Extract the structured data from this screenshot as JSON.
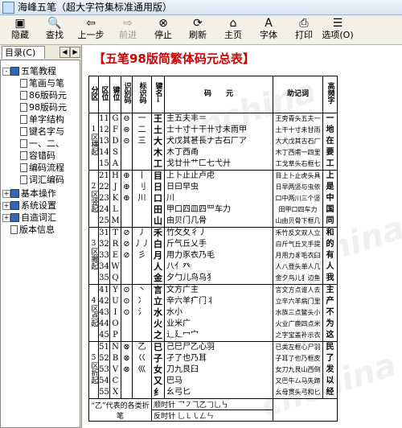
{
  "window": {
    "title": "海峰五笔（超大字符集标准通用版）"
  },
  "toolbar": {
    "buttons": [
      {
        "id": "hide",
        "label": "隐藏",
        "icon": "hide-icon",
        "glyph": "▣"
      },
      {
        "id": "find",
        "label": "查找",
        "icon": "find-icon",
        "glyph": "🔍"
      },
      {
        "id": "back",
        "label": "上一步",
        "icon": "back-arrow-icon",
        "glyph": "⇦"
      },
      {
        "id": "forward",
        "label": "前进",
        "icon": "forward-arrow-icon",
        "glyph": "⇨",
        "disabled": true
      },
      {
        "id": "stop",
        "label": "停止",
        "icon": "stop-icon",
        "glyph": "⊗"
      },
      {
        "id": "refresh",
        "label": "刷新",
        "icon": "refresh-icon",
        "glyph": "⟳"
      },
      {
        "id": "home",
        "label": "主页",
        "icon": "home-icon",
        "glyph": "⌂"
      },
      {
        "id": "font",
        "label": "字体",
        "icon": "font-icon",
        "glyph": "A"
      },
      {
        "id": "print",
        "label": "打印",
        "icon": "print-icon",
        "glyph": "⎙"
      },
      {
        "id": "options",
        "label": "选项(O)",
        "icon": "options-icon",
        "glyph": "☰"
      }
    ]
  },
  "sidebar": {
    "tab_label": "目录(C)",
    "tree": [
      {
        "label": "五笔教程",
        "type": "book",
        "level": 0,
        "expander": "-"
      },
      {
        "label": "笔画与笔",
        "type": "doc",
        "level": 1
      },
      {
        "label": "86版码元",
        "type": "doc",
        "level": 1
      },
      {
        "label": "98版码元",
        "type": "doc",
        "level": 1
      },
      {
        "label": "单字结构",
        "type": "doc",
        "level": 1
      },
      {
        "label": "键名字与",
        "type": "doc",
        "level": 1
      },
      {
        "label": "一、二、",
        "type": "doc",
        "level": 1
      },
      {
        "label": "容错码",
        "type": "doc",
        "level": 1
      },
      {
        "label": "编码流程",
        "type": "doc",
        "level": 1
      },
      {
        "label": "词汇编码",
        "type": "doc",
        "level": 1
      },
      {
        "label": "基本操作",
        "type": "book",
        "level": 0,
        "expander": "+"
      },
      {
        "label": "系统设置",
        "type": "book",
        "level": 0,
        "expander": "+"
      },
      {
        "label": "自造词汇",
        "type": "book",
        "level": 0,
        "expander": "+"
      },
      {
        "label": "版本信息",
        "type": "doc",
        "level": 0
      }
    ]
  },
  "content": {
    "page_title": "【五笔98版简繁体码元总表】",
    "watermark": "cnchina",
    "headers": {
      "zone": "分区",
      "pos": "区位",
      "key": "键位",
      "code": "识别码",
      "mark": "标识码",
      "keyname": "键名↓",
      "elements": "码　　元",
      "mnemonic": "助记词",
      "freq": "高频字"
    },
    "zones": [
      {
        "label": "1区横起",
        "rows": [
          {
            "pos": "11",
            "key": "G",
            "code": "⊖",
            "mark": "一",
            "keyname": "王",
            "elements": "主五夫丰＝",
            "mnemonic": "王旁青头五夫一",
            "freq": "一"
          },
          {
            "pos": "12",
            "key": "F",
            "code": "⊜",
            "mark": "二",
            "keyname": "土",
            "elements": "士十寸十干卄寸未雨甲",
            "mnemonic": "土干十寸未甘雨",
            "freq": "地"
          },
          {
            "pos": "13",
            "key": "D",
            "code": "⊝",
            "mark": "三",
            "keyname": "大",
            "elements": "犬戊其甚長ナ古石厂ア",
            "mnemonic": "大犬戊其古石厂",
            "freq": "在"
          },
          {
            "pos": "14",
            "key": "S",
            "code": "",
            "mark": "",
            "keyname": "木",
            "elements": "木丁西甬",
            "mnemonic": "木丁西甫一四里",
            "freq": "要"
          },
          {
            "pos": "15",
            "key": "A",
            "code": "",
            "mark": "",
            "keyname": "工",
            "elements": "戈廿卄艹匚七弋廾",
            "mnemonic": "工戈草头右框七",
            "freq": "工"
          }
        ]
      },
      {
        "label": "2区竖起",
        "rows": [
          {
            "pos": "21",
            "key": "H",
            "code": "⊕",
            "mark": "丨",
            "keyname": "目",
            "elements": "上卜止止卢虍",
            "mnemonic": "目上卜止虎头具",
            "freq": "上"
          },
          {
            "pos": "22",
            "key": "J",
            "code": "⊕",
            "mark": "刂",
            "keyname": "日",
            "elements": "日曰早虫",
            "mnemonic": "日早两竖与虫依",
            "freq": "是"
          },
          {
            "pos": "23",
            "key": "K",
            "code": "⊕",
            "mark": "川",
            "keyname": "口",
            "elements": "川",
            "mnemonic": "口中两川三个竖",
            "freq": "中"
          },
          {
            "pos": "24",
            "key": "L",
            "code": "",
            "mark": "",
            "keyname": "田",
            "elements": "甲口四皿四罒车力",
            "mnemonic": "田甲口四车力",
            "freq": "国"
          },
          {
            "pos": "25",
            "key": "M",
            "code": "",
            "mark": "",
            "keyname": "山",
            "elements": "由贝门几骨",
            "mnemonic": "山由贝骨下框几",
            "freq": "同"
          }
        ]
      },
      {
        "label": "3区撇起",
        "rows": [
          {
            "pos": "31",
            "key": "T",
            "code": "⊘",
            "mark": "丿",
            "keyname": "禾",
            "elements": "竹攵夂彳丿",
            "mnemonic": "禾竹反文双人立",
            "freq": "和"
          },
          {
            "pos": "32",
            "key": "R",
            "code": "⊘",
            "mark": "丿丿",
            "keyname": "白",
            "elements": "斤气丘乂手",
            "mnemonic": "白斤气丘叉手提",
            "freq": "的"
          },
          {
            "pos": "33",
            "key": "E",
            "code": "⊘",
            "mark": "彡",
            "keyname": "月",
            "elements": "用力豕衣乃毛",
            "mnemonic": "月用力豸毛衣臼",
            "freq": "有"
          },
          {
            "pos": "34",
            "key": "W",
            "code": "",
            "mark": "",
            "keyname": "人",
            "elements": "八亻癶",
            "mnemonic": "人八登头单人几",
            "freq": "人"
          },
          {
            "pos": "35",
            "key": "Q",
            "code": "",
            "mark": "",
            "keyname": "金",
            "elements": "夕勹儿鸟乌犭",
            "mnemonic": "金夕鸟儿犭边鱼",
            "freq": "我"
          }
        ]
      },
      {
        "label": "4区点起",
        "rows": [
          {
            "pos": "41",
            "key": "Y",
            "code": "⊙",
            "mark": "丶",
            "keyname": "言",
            "elements": "文方广主",
            "mnemonic": "言文方点谁人去",
            "freq": "主"
          },
          {
            "pos": "42",
            "key": "U",
            "code": "⊙",
            "mark": "冫",
            "keyname": "立",
            "elements": "辛六羊疒门丬",
            "mnemonic": "立辛六羊病门里",
            "freq": "产"
          },
          {
            "pos": "43",
            "key": "I",
            "code": "⊙",
            "mark": "氵",
            "keyname": "水",
            "elements": "水小",
            "mnemonic": "水族三点鳖头小",
            "freq": "不"
          },
          {
            "pos": "44",
            "key": "O",
            "code": "",
            "mark": "",
            "keyname": "火",
            "elements": "业米广",
            "mnemonic": "火业广鹿四点米",
            "freq": "为"
          },
          {
            "pos": "45",
            "key": "P",
            "code": "",
            "mark": "",
            "keyname": "之",
            "elements": "辶廴冖宀",
            "mnemonic": "之字宝盖补示衣",
            "freq": "这"
          }
        ]
      },
      {
        "label": "5区折起",
        "rows": [
          {
            "pos": "51",
            "key": "N",
            "code": "⊗",
            "mark": "乙",
            "keyname": "已",
            "elements": "己巳尸乙心羽",
            "mnemonic": "已类左框心尸羽",
            "freq": "民"
          },
          {
            "pos": "52",
            "key": "B",
            "code": "⊗",
            "mark": "巜",
            "keyname": "子",
            "elements": "孑了也乃耳",
            "mnemonic": "子耳了也乃框皮",
            "freq": "了"
          },
          {
            "pos": "53",
            "key": "V",
            "code": "⊗",
            "mark": "巛",
            "keyname": "女",
            "elements": "刀九艮臼",
            "mnemonic": "女刀九艮山西倒",
            "freq": "发"
          },
          {
            "pos": "54",
            "key": "C",
            "code": "",
            "mark": "",
            "keyname": "又",
            "elements": "巴马",
            "mnemonic": "又巴牛厶马失蹄",
            "freq": "以"
          },
          {
            "pos": "55",
            "key": "X",
            "code": "",
            "mark": "",
            "keyname": "纟",
            "elements": "幺弓匕",
            "mnemonic": "幺母贯头弓和匕",
            "freq": "经"
          }
        ]
      }
    ],
    "footer": {
      "note": "“乙”代表的各类折笔",
      "clockwise": "顺时针",
      "counterclockwise": "反时针",
      "cw_strokes": "乛㇇⺄乙𠃌乚㇉",
      "ccw_strokes": "乚㇄㇂ㄥㄣ"
    }
  }
}
